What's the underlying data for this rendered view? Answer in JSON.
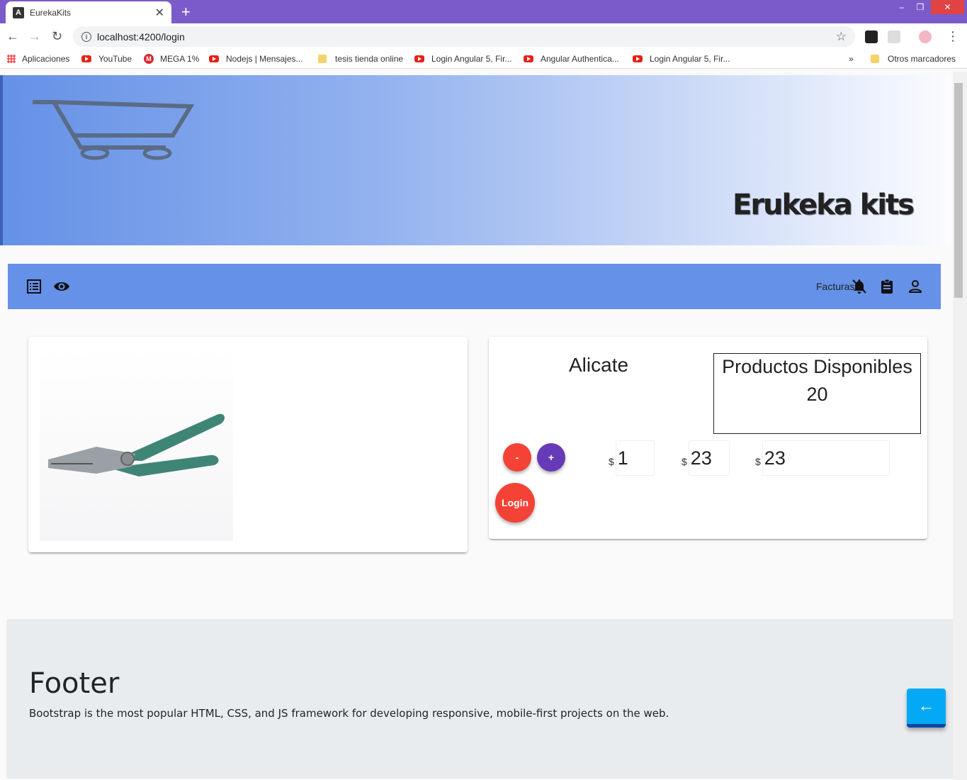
{
  "browser": {
    "tab_title": "EurekaKits",
    "new_tab": "+",
    "url": "localhost:4200/login",
    "window_controls": [
      "minimize",
      "restore",
      "close"
    ],
    "bookmarks": [
      {
        "label": "Aplicaciones",
        "icon": "apps-grid-icon"
      },
      {
        "label": "YouTube",
        "icon": "youtube-icon"
      },
      {
        "label": "MEGA 1%",
        "icon": "mega-icon"
      },
      {
        "label": "Nodejs | Mensajes...",
        "icon": "youtube-icon"
      },
      {
        "label": "tesis tienda online",
        "icon": "folder-icon"
      },
      {
        "label": "Login Angular 5, Fir...",
        "icon": "youtube-icon"
      },
      {
        "label": "Angular Authentica...",
        "icon": "youtube-icon"
      },
      {
        "label": "Login Angular 5, Fir...",
        "icon": "youtube-icon"
      },
      {
        "label": "Otros marcadores",
        "icon": "folder-icon"
      }
    ],
    "more": "»"
  },
  "banner": {
    "brand": "Erukeka kits"
  },
  "toolbar": {
    "facturas_label": "Facturas"
  },
  "product": {
    "name": "Alicate",
    "stock_title": "Productos Disponibles",
    "stock_value": "20",
    "minus_label": "-",
    "plus_label": "+",
    "login_label": "Login",
    "currency": "$",
    "quantity": "1",
    "unit_price": "23",
    "total": "23",
    "image_alt": "pliers"
  },
  "footer": {
    "title": "Footer",
    "text": "Bootstrap is the most popular HTML, CSS, and JS framework for developing responsive, mobile-first projects on the web."
  },
  "colors": {
    "tabbar": "#7b5bc9",
    "toolbar": "#6591e8",
    "fab_red": "#f44336",
    "fab_purple": "#673ab7",
    "back_button": "#03a9f4"
  }
}
